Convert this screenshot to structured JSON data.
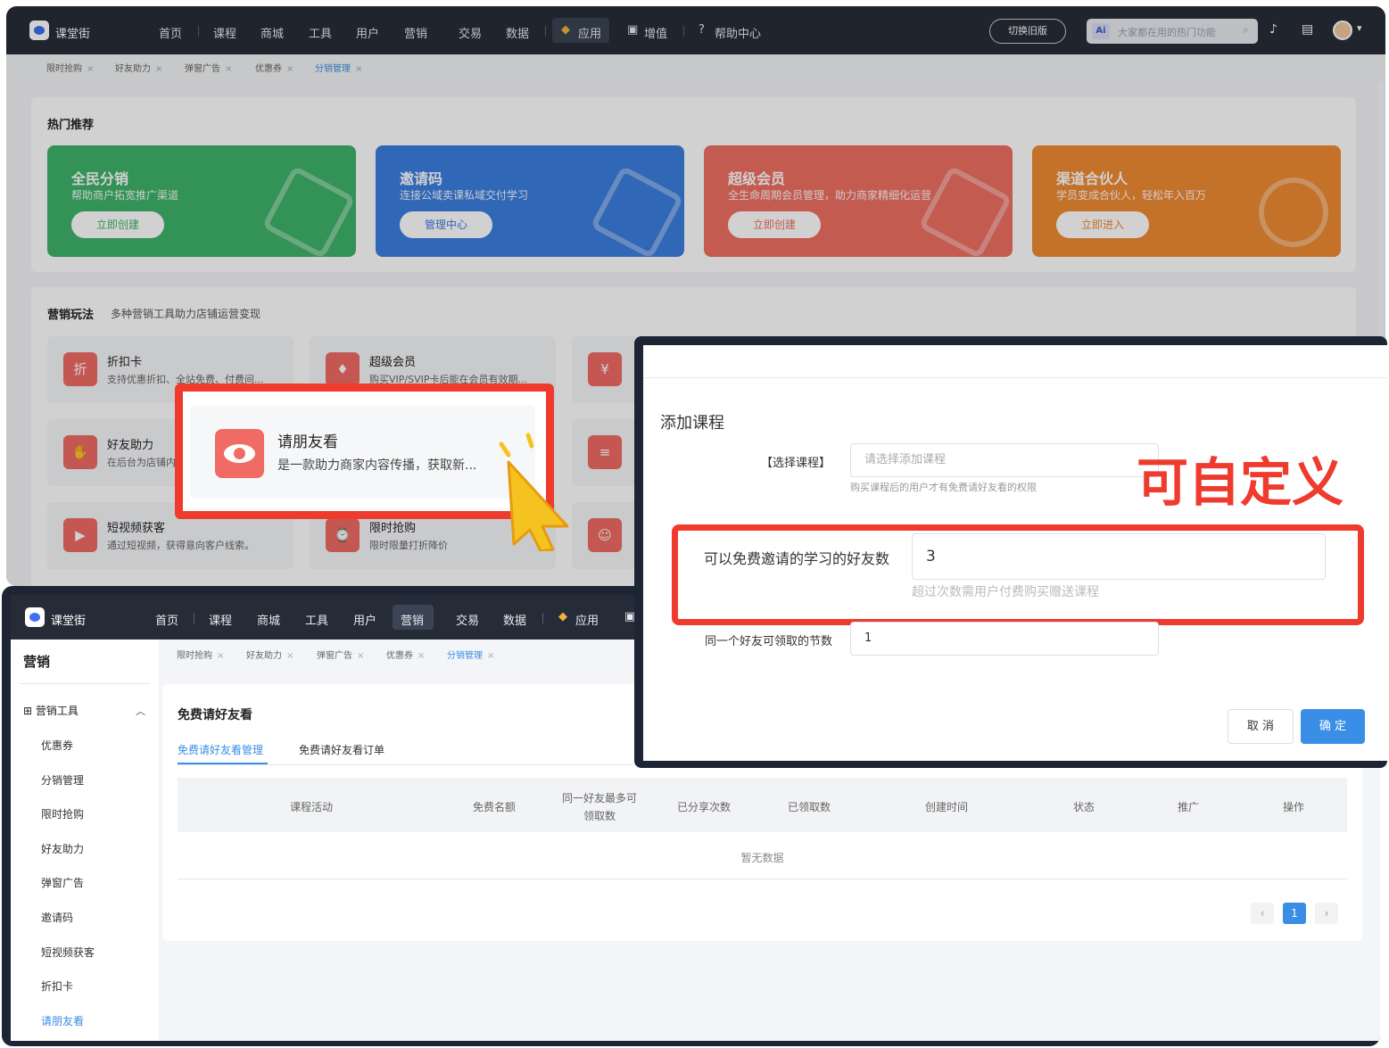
{
  "brand": "课堂街",
  "nav": [
    "首页",
    "课程",
    "商城",
    "工具",
    "用户",
    "营销",
    "交易",
    "数据"
  ],
  "nav_app": "应用",
  "nav_value_added": "增值",
  "nav_help": "帮助中心",
  "switch_old": "切换旧版",
  "search": {
    "ai": "Ai",
    "placeholder": "大家都在用的热门功能"
  },
  "tabs": [
    "限时抢购",
    "好友助力",
    "弹窗广告",
    "优惠券",
    "分销管理"
  ],
  "hot": {
    "title": "热门推荐",
    "cards": [
      {
        "title": "全民分销",
        "desc": "帮助商户拓宽推广渠道",
        "btn": "立即创建",
        "color": "#3fb36a"
      },
      {
        "title": "邀请码",
        "desc": "连接公域卖课私域交付学习",
        "btn": "管理中心",
        "color": "#3b7ee0"
      },
      {
        "title": "超级会员",
        "desc": "全生命周期会员管理，助力商家精细化运营",
        "btn": "立即创建",
        "color": "#ef6f62"
      },
      {
        "title": "渠道合伙人",
        "desc": "学员变成合伙人，轻松年入百万",
        "btn": "立即进入",
        "color": "#f08a33"
      }
    ]
  },
  "marketing": {
    "title": "营销玩法",
    "subtitle": "多种营销工具助力店铺运营变现",
    "tools": [
      {
        "title": "折扣卡",
        "desc": "支持优惠折扣、全站免费、付费间...",
        "icon": "折"
      },
      {
        "title": "超级会员",
        "desc": "购买VIP/SVIP卡后能在会员有效期...",
        "icon": "♦"
      },
      {
        "title": "好友助力",
        "desc": "在后台为店铺内",
        "icon": "✋"
      },
      {
        "title": "短视频获客",
        "desc": "通过短视频，获得意向客户线索。",
        "icon": "▶"
      },
      {
        "title": "限时抢购",
        "desc": "限时限量打折降价",
        "icon": "⌚"
      }
    ],
    "highlight": {
      "title": "请朋友看",
      "desc": "是一款助力商家内容传播，获取新..."
    }
  },
  "sidebar": {
    "title": "营销",
    "group": "营销工具",
    "items": [
      "优惠券",
      "分销管理",
      "限时抢购",
      "好友助力",
      "弹窗广告",
      "邀请码",
      "短视频获客",
      "折扣卡",
      "请朋友看"
    ]
  },
  "panel": {
    "title": "免费请好友看",
    "tabs": [
      "免费请好友看管理",
      "免费请好友看订单"
    ],
    "columns": [
      "课程活动",
      "免费名额",
      "同一好友最多可",
      "领取数",
      "已分享次数",
      "已领取数",
      "创建时间",
      "状态",
      "推广",
      "操作"
    ],
    "empty": "暂无数据",
    "prev": "‹",
    "page": "1",
    "next": "›"
  },
  "modal": {
    "title": "添加课程",
    "course_label": "【选择课程】",
    "course_placeholder": "请选择添加课程",
    "course_help": "购买课程后的用户才有免费请好友看的权限",
    "custom": "可自定义",
    "invite_label": "可以免费邀请的学习的好友数",
    "invite_value": "3",
    "invite_help": "超过次数需用户付费购买赠送课程",
    "sections_label": "同一个好友可领取的节数",
    "sections_value": "1",
    "cancel": "取 消",
    "ok": "确 定"
  }
}
